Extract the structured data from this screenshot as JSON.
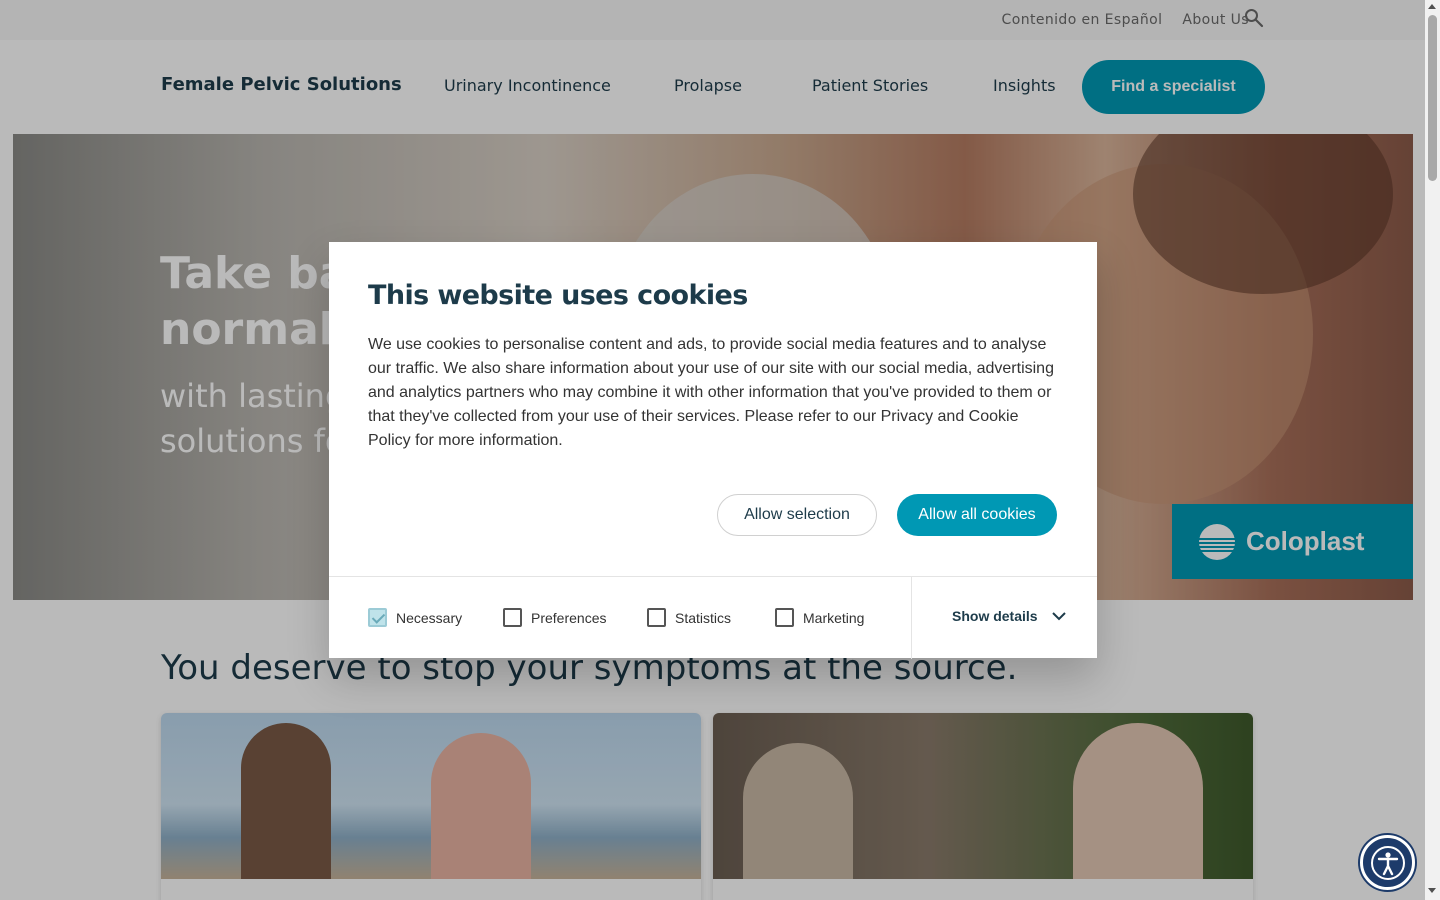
{
  "topbar": {
    "links": [
      "Contenido en Español",
      "About Us"
    ],
    "search_icon": "search-icon"
  },
  "header": {
    "logo": "Female Pelvic Solutions",
    "nav": [
      "Urinary Incontinence",
      "Prolapse",
      "Patient Stories",
      "Insights"
    ],
    "cta": "Find a specialist"
  },
  "hero": {
    "headline_line1": "Take ba",
    "headline_line2": "normal",
    "sub_line1": "with lasting",
    "sub_line2": "solutions fo",
    "brand": "Coloplast"
  },
  "section": {
    "title": "You deserve to stop your symptoms at the source."
  },
  "cookie_dialog": {
    "title": "This website uses cookies",
    "body": "We use cookies to personalise content and ads, to provide social media features and to analyse our traffic. We also share information about your use of our site with our social media, advertising and analytics partners who may combine it with other information that you've provided to them or that they've collected from your use of their services. Please refer to our Privacy and Cookie Policy for more information.",
    "allow_selection": "Allow selection",
    "allow_all": "Allow all cookies",
    "checkboxes": [
      {
        "label": "Necessary",
        "checked": true,
        "disabled": true
      },
      {
        "label": "Preferences",
        "checked": false
      },
      {
        "label": "Statistics",
        "checked": false
      },
      {
        "label": "Marketing",
        "checked": false
      }
    ],
    "show_details": "Show details"
  },
  "colors": {
    "accent": "#0098b4",
    "text": "#1d3b4a",
    "overlay": "rgba(0,0,0,0.27)"
  }
}
